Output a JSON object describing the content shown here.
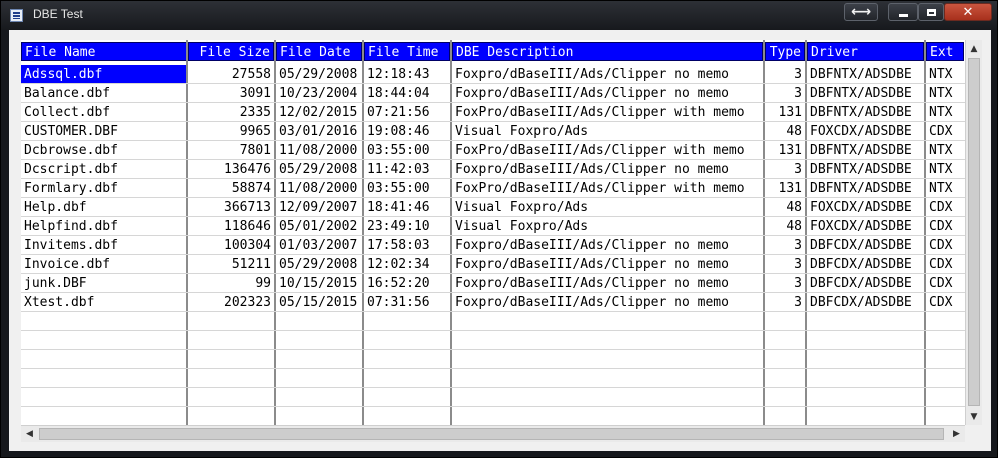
{
  "window": {
    "title": "DBE Test",
    "icons": {
      "app": "app-list-icon",
      "swap": "swap-arrows-icon",
      "minimize": "minimize-icon",
      "maximize": "maximize-icon",
      "close": "close-icon"
    },
    "swap_glyph": "⟷",
    "close_glyph": "✕"
  },
  "colors": {
    "header_bg": "#0000ff",
    "header_text": "#ffffff",
    "selected_bg": "#0000ff",
    "close_button": "#c0462f"
  },
  "columns": [
    "File Name",
    "File Size",
    "File Date",
    "File Time",
    "DBE Description",
    "Type",
    "Driver",
    "Ext"
  ],
  "rows": [
    [
      "Adssql.dbf",
      "27558",
      "05/29/2008",
      "12:18:43",
      "Foxpro/dBaseIII/Ads/Clipper no memo",
      "3",
      "DBFNTX/ADSDBE",
      "NTX"
    ],
    [
      "Balance.dbf",
      "3091",
      "10/23/2004",
      "18:44:04",
      "Foxpro/dBaseIII/Ads/Clipper no memo",
      "3",
      "DBFNTX/ADSDBE",
      "NTX"
    ],
    [
      "Collect.dbf",
      "2335",
      "12/02/2015",
      "07:21:56",
      "FoxPro/dBaseIII/Ads/Clipper with memo",
      "131",
      "DBFNTX/ADSDBE",
      "NTX"
    ],
    [
      "CUSTOMER.DBF",
      "9965",
      "03/01/2016",
      "19:08:46",
      "Visual Foxpro/Ads",
      "48",
      "FOXCDX/ADSDBE",
      "CDX"
    ],
    [
      "Dcbrowse.dbf",
      "7801",
      "11/08/2000",
      "03:55:00",
      "FoxPro/dBaseIII/Ads/Clipper with memo",
      "131",
      "DBFNTX/ADSDBE",
      "NTX"
    ],
    [
      "Dcscript.dbf",
      "136476",
      "05/29/2008",
      "11:42:03",
      "Foxpro/dBaseIII/Ads/Clipper no memo",
      "3",
      "DBFNTX/ADSDBE",
      "NTX"
    ],
    [
      "Formlary.dbf",
      "58874",
      "11/08/2000",
      "03:55:00",
      "FoxPro/dBaseIII/Ads/Clipper with memo",
      "131",
      "DBFNTX/ADSDBE",
      "NTX"
    ],
    [
      "Help.dbf",
      "366713",
      "12/09/2007",
      "18:41:46",
      "Visual Foxpro/Ads",
      "48",
      "FOXCDX/ADSDBE",
      "CDX"
    ],
    [
      "Helpfind.dbf",
      "118646",
      "05/01/2002",
      "23:49:10",
      "Visual Foxpro/Ads",
      "48",
      "FOXCDX/ADSDBE",
      "CDX"
    ],
    [
      "Invitems.dbf",
      "100304",
      "01/03/2007",
      "17:58:03",
      "Foxpro/dBaseIII/Ads/Clipper no memo",
      "3",
      "DBFCDX/ADSDBE",
      "CDX"
    ],
    [
      "Invoice.dbf",
      "51211",
      "05/29/2008",
      "12:02:34",
      "Foxpro/dBaseIII/Ads/Clipper no memo",
      "3",
      "DBFCDX/ADSDBE",
      "CDX"
    ],
    [
      "junk.DBF",
      "99",
      "10/15/2015",
      "16:52:20",
      "Foxpro/dBaseIII/Ads/Clipper no memo",
      "3",
      "DBFCDX/ADSDBE",
      "CDX"
    ],
    [
      "Xtest.dbf",
      "202323",
      "05/15/2015",
      "07:31:56",
      "Foxpro/dBaseIII/Ads/Clipper no memo",
      "3",
      "DBFCDX/ADSDBE",
      "CDX"
    ]
  ],
  "selected_row": 0,
  "scroll_arrows": {
    "up": "▲",
    "down": "▼",
    "left": "◀",
    "right": "▶"
  }
}
